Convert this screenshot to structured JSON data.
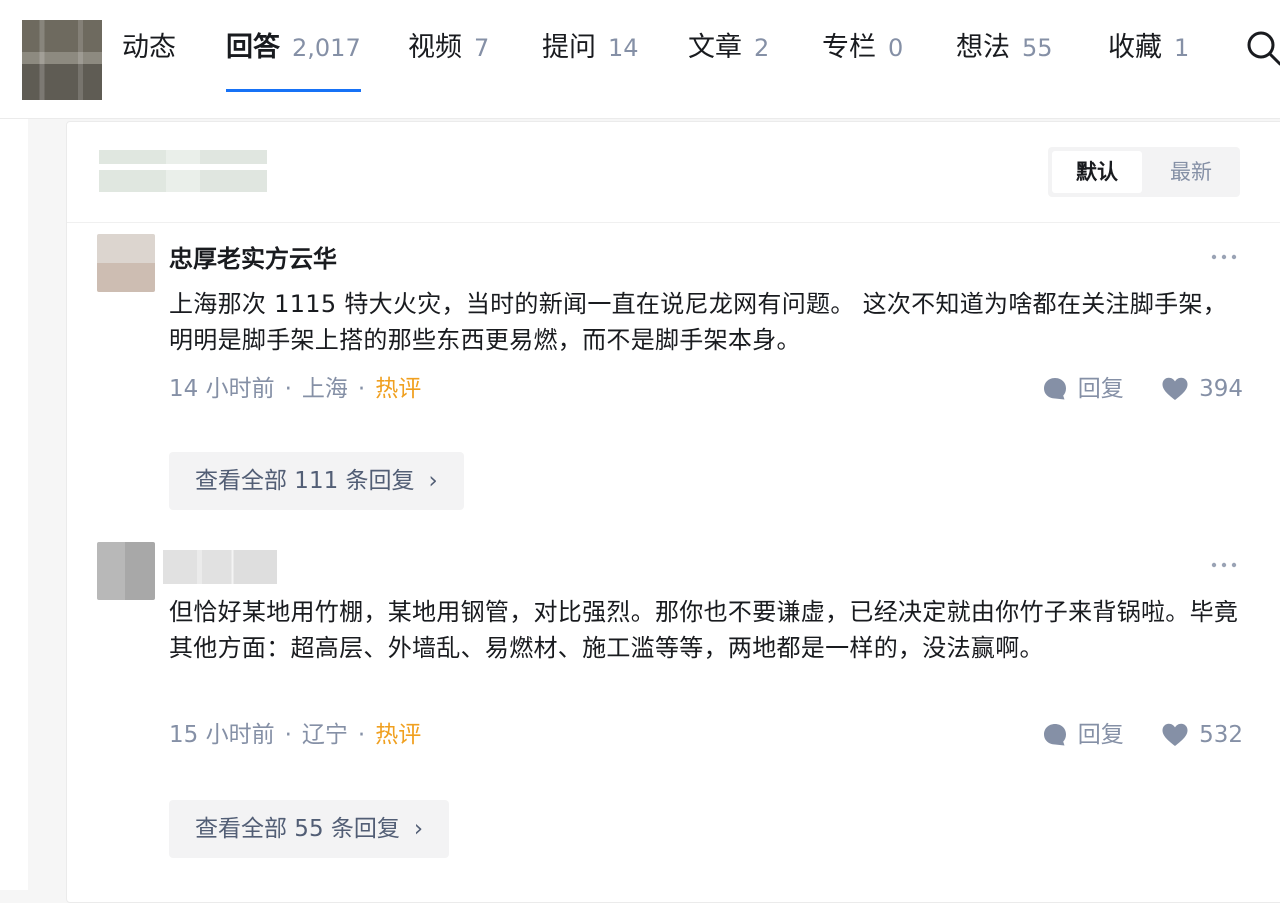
{
  "nav": {
    "tabs": [
      {
        "label": "动态",
        "count": ""
      },
      {
        "label": "回答",
        "count": "2,017"
      },
      {
        "label": "视频",
        "count": "7"
      },
      {
        "label": "提问",
        "count": "14"
      },
      {
        "label": "文章",
        "count": "2"
      },
      {
        "label": "专栏",
        "count": "0"
      },
      {
        "label": "想法",
        "count": "55"
      },
      {
        "label": "收藏",
        "count": "1"
      }
    ],
    "active_tab": "回答"
  },
  "sort": {
    "default_label": "默认",
    "latest_label": "最新"
  },
  "comments": [
    {
      "author": "忠厚老实方云华",
      "text": "上海那次 1115 特大火灾，当时的新闻一直在说尼龙网有问题。 这次不知道为啥都在关注脚手架，明明是脚手架上搭的那些东西更易燃，而不是脚手架本身。",
      "time": "14 小时前",
      "location": "上海",
      "badge": "热评",
      "reply_label": "回复",
      "likes": "394",
      "view_replies": "查看全部 111 条回复"
    },
    {
      "author": "",
      "text": "但恰好某地用竹棚，某地用钢管，对比强烈。那你也不要谦虚，已经决定就由你竹子来背锅啦。毕竟其他方面：超高层、外墙乱、易燃材、施工滥等等，两地都是一样的，没法赢啊。",
      "time": "15 小时前",
      "location": "辽宁",
      "badge": "热评",
      "reply_label": "回复",
      "likes": "532",
      "view_replies": "查看全部 55 条回复"
    }
  ],
  "colors": {
    "accent": "#1772f6",
    "muted": "#8590a6",
    "hot": "#f0a020"
  },
  "icons": [
    "search-icon",
    "more-icon",
    "comment-bubble-icon",
    "heart-icon",
    "chevron-right-icon"
  ]
}
